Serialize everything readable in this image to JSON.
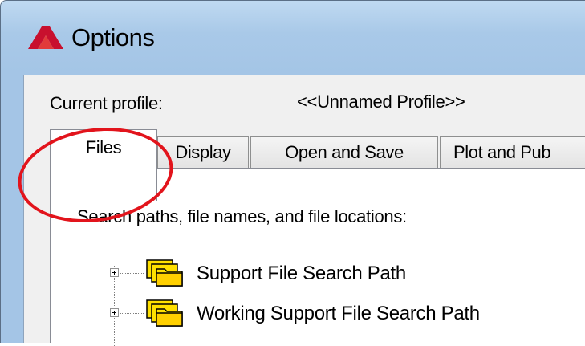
{
  "window": {
    "title": "Options",
    "icon": "autocad-logo-icon"
  },
  "profile": {
    "label": "Current profile:",
    "value": "<<Unnamed Profile>>"
  },
  "tabs": [
    {
      "label": "Files",
      "active": true
    },
    {
      "label": "Display",
      "active": false
    },
    {
      "label": "Open and Save",
      "active": false
    },
    {
      "label": "Plot and Pub",
      "active": false
    }
  ],
  "files_panel": {
    "caption": "Search paths, file names, and file locations:",
    "tree": [
      {
        "label": "Support File Search Path",
        "icon": "folder-stack-icon",
        "expander": "plus"
      },
      {
        "label": "Working Support File Search Path",
        "icon": "folder-stack-icon",
        "expander": "plus"
      }
    ]
  },
  "colors": {
    "annotation_circle": "#e2141c",
    "title_bar": "#bfd9f1",
    "logo_red": "#c8102e"
  }
}
